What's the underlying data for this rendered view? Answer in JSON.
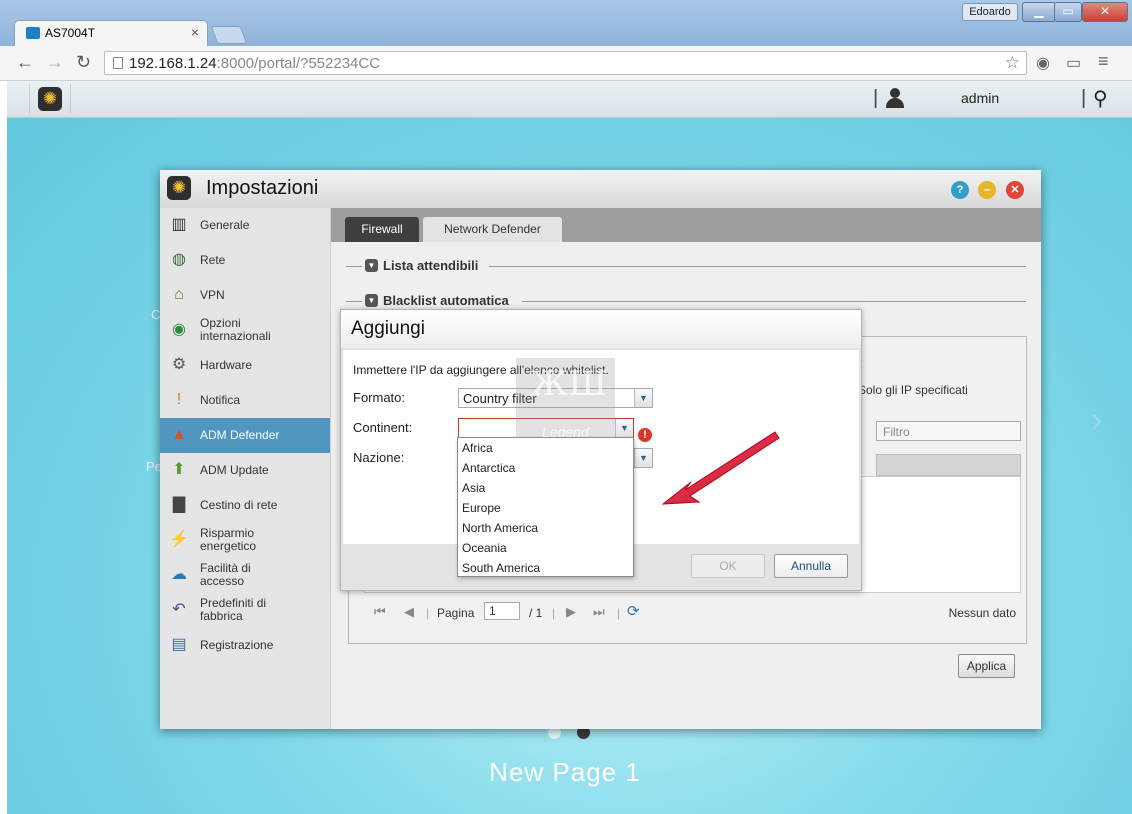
{
  "browser": {
    "tab_title": "AS7004T",
    "tab_close": "×",
    "user_name": "Edoardo",
    "url_host": "192.168.1.24",
    "url_rest": ":8000/portal/?552234CC",
    "back": "←",
    "forward": "→",
    "reload": "↻",
    "star": "☆",
    "menu": "≡"
  },
  "adm": {
    "username": "admin",
    "page_label": "New Page 1",
    "bg_left_1": "C",
    "bg_left_2": "Pe"
  },
  "settings_window": {
    "title": "Impostazioni",
    "nav": [
      {
        "label": "Generale",
        "icon": "▥"
      },
      {
        "label": "Rete",
        "icon": "◍"
      },
      {
        "label": "VPN",
        "icon": "⌂"
      },
      {
        "label": "Opzioni internazionali",
        "icon": "◉"
      },
      {
        "label": "Hardware",
        "icon": "⚙"
      },
      {
        "label": "Notifica",
        "icon": "!"
      },
      {
        "label": "ADM Defender",
        "icon": "▲"
      },
      {
        "label": "ADM Update",
        "icon": "⬆"
      },
      {
        "label": "Cestino di rete",
        "icon": "▇"
      },
      {
        "label": "Risparmio energetico",
        "icon": "⚡"
      },
      {
        "label": "Facilità di accesso",
        "icon": "☁"
      },
      {
        "label": "Predefiniti di fabbrica",
        "icon": "↶"
      },
      {
        "label": "Registrazione",
        "icon": "▤"
      }
    ],
    "active_nav_index": 6,
    "tabs": [
      {
        "label": "Firewall",
        "active": false
      },
      {
        "label": "Network Defender",
        "active": true
      }
    ],
    "section_trusted": "Lista attendibili",
    "section_blacklist": "Blacklist automatica",
    "behind_t": "t",
    "behind_only_ip": "Solo gli IP specificati",
    "filter_placeholder": "Filtro",
    "pager": {
      "page_label": "Pagina",
      "page_value": "1",
      "page_total": "/ 1",
      "empty": "Nessun dato"
    },
    "apply_label": "Applica"
  },
  "dialog": {
    "title": "Aggiungi",
    "description": "Immettere l'IP da aggiungere all'elenco whitelist.",
    "format_label": "Formato:",
    "format_value": "Country filter",
    "continent_label": "Continent:",
    "continent_value": "",
    "nation_label": "Nazione:",
    "error_mark": "!",
    "ok_label": "OK",
    "cancel_label": "Annulla",
    "continent_options": [
      "Africa",
      "Antarctica",
      "Asia",
      "Europe",
      "North America",
      "Oceania",
      "South America"
    ]
  },
  "watermark": {
    "line1": "ЖШ",
    "line2": "Legend"
  },
  "colors": {
    "accent": "#4f97be",
    "error": "#d9382a",
    "arrow": "#e0182d",
    "help": "#2f9fc8",
    "minimize": "#e8b62c",
    "close": "#e0453a"
  }
}
